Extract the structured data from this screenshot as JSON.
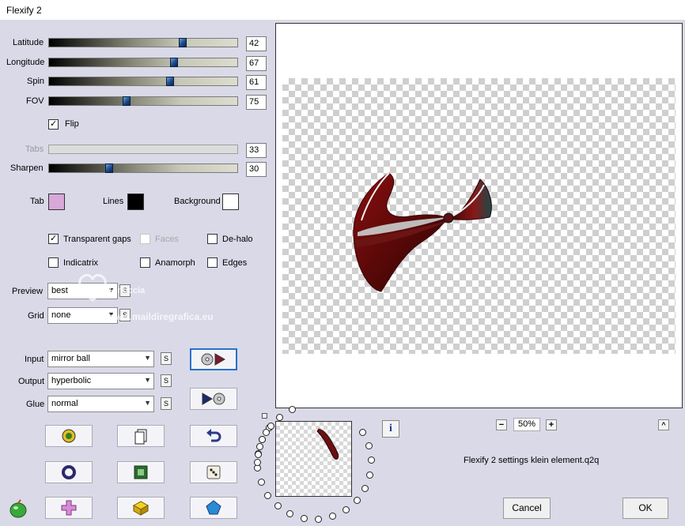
{
  "window": {
    "title": "Flexify 2"
  },
  "sliders": [
    {
      "label": "Latitude",
      "value": "42",
      "level": 0.72
    },
    {
      "label": "Longitude",
      "value": "67",
      "level": 0.67
    },
    {
      "label": "Spin",
      "value": "61",
      "level": 0.65
    },
    {
      "label": "FOV",
      "value": "75",
      "level": 0.41
    }
  ],
  "flip": {
    "label": "Flip",
    "checked": true
  },
  "tabs_slider": {
    "label": "Tabs",
    "value": "33",
    "disabled": true
  },
  "sharpen": {
    "label": "Sharpen",
    "value": "30",
    "level": 0.31
  },
  "colors": {
    "tab": {
      "label": "Tab",
      "color": "#d8a8d8"
    },
    "lines": {
      "label": "Lines",
      "color": "#000000"
    },
    "background": {
      "label": "Background",
      "color": "#ffffff"
    }
  },
  "options": {
    "transparent_gaps": {
      "label": "Transparent gaps",
      "checked": true
    },
    "faces": {
      "label": "Faces",
      "checked": false,
      "disabled": true
    },
    "de_halo": {
      "label": "De-halo",
      "checked": false
    },
    "indicatrix": {
      "label": "Indicatrix",
      "checked": false
    },
    "anamorph": {
      "label": "Anamorph",
      "checked": false
    },
    "edges": {
      "label": "Edges",
      "checked": false
    }
  },
  "preview_select": {
    "label": "Preview",
    "value": "best"
  },
  "grid_select": {
    "label": "Grid",
    "value": "none"
  },
  "input_select": {
    "label": "Input",
    "value": "mirror ball"
  },
  "output_select": {
    "label": "Output",
    "value": "hyperbolic"
  },
  "glue_select": {
    "label": "Glue",
    "value": "normal"
  },
  "s_button_label": "S",
  "watermark": {
    "line1": "Pinuccia",
    "line2": "www.maildiregrafica.eu"
  },
  "zoom": {
    "value": "50%",
    "minus": "−",
    "plus": "+"
  },
  "settings_file": "Flexify 2 settings klein element.q2q",
  "info_label": "i",
  "collapse_label": "^",
  "buttons": {
    "cancel": "Cancel",
    "ok": "OK"
  },
  "icons": [
    "input-output-swap-icon",
    "output-input-swap-icon",
    "random-bug-icon",
    "page-copy-icon",
    "undo-icon",
    "ring-icon",
    "green-square-icon",
    "dice-icon",
    "pink-cross-icon",
    "yellow-box-icon",
    "blue-gem-icon",
    "flexify-logo-icon"
  ]
}
